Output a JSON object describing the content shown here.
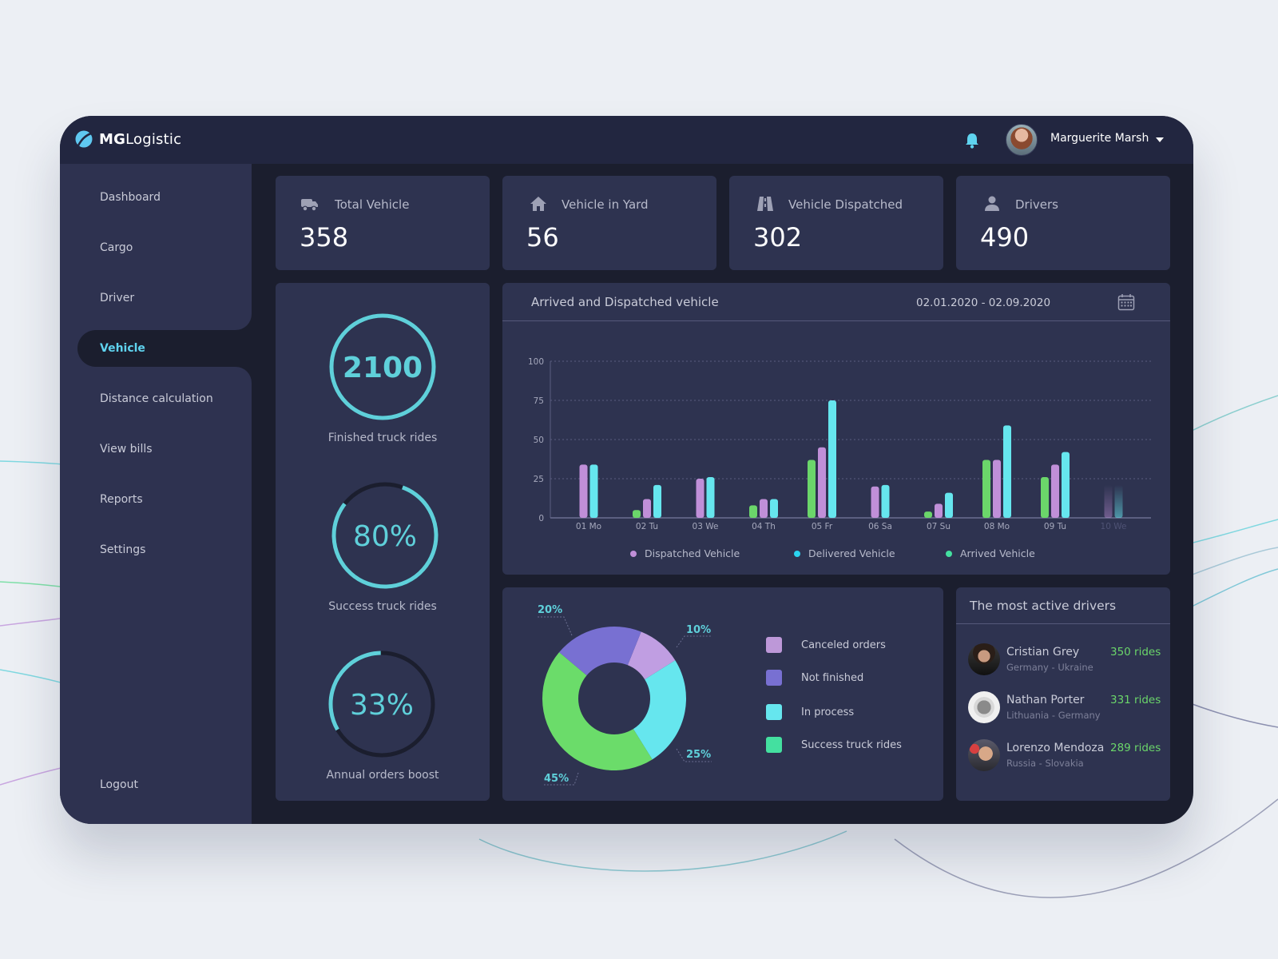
{
  "app": {
    "brand_bold": "MG",
    "brand_light": "Logistic",
    "user_name": "Marguerite Marsh"
  },
  "sidebar": {
    "items": [
      {
        "label": "Dashboard",
        "active": false
      },
      {
        "label": "Cargo",
        "active": false
      },
      {
        "label": "Driver",
        "active": false
      },
      {
        "label": "Vehicle",
        "active": true
      },
      {
        "label": "Distance calculation",
        "active": false
      },
      {
        "label": "View bills",
        "active": false
      },
      {
        "label": "Reports",
        "active": false
      },
      {
        "label": "Settings",
        "active": false
      }
    ],
    "logout": "Logout"
  },
  "stats": [
    {
      "icon": "truck-icon",
      "label": "Total Vehicle",
      "value": "358"
    },
    {
      "icon": "home-icon",
      "label": "Vehicle in Yard",
      "value": "56"
    },
    {
      "icon": "road-icon",
      "label": "Vehicle Dispatched",
      "value": "302"
    },
    {
      "icon": "user-icon",
      "label": "Drivers",
      "value": "490"
    }
  ],
  "rings": [
    {
      "value": "2100",
      "caption": "Finished truck rides",
      "progress": 1.0
    },
    {
      "value": "80%",
      "caption": "Success truck rides",
      "progress": 0.8
    },
    {
      "value": "33%",
      "caption": "Annual orders boost",
      "progress": 0.33
    }
  ],
  "colors": {
    "accent": "#5fd0da",
    "dispatched": "#c08fd8",
    "delivered": "#66e6ee",
    "arrived": "#6bd66a",
    "canceled": "#c09ee2",
    "not_finished": "#7870d2",
    "in_process": "#66e6ee",
    "success": "#6bdc6a",
    "success_legend": "#44e0a0",
    "rides_green": "#6bd66a"
  },
  "bar_chart": {
    "title": "Arrived and Dispatched vehicle",
    "date_range": "02.01.2020 - 02.09.2020"
  },
  "chart_data": [
    {
      "type": "bar",
      "title": "Arrived and Dispatched vehicle",
      "xlabel": "",
      "ylabel": "",
      "ylim": [
        0,
        100
      ],
      "yticks": [
        0,
        25,
        50,
        75,
        100
      ],
      "grid": true,
      "legend_position": "bottom",
      "categories": [
        "01 Mo",
        "02 Tu",
        "03 We",
        "04 Th",
        "05 Fr",
        "06 Sa",
        "07 Su",
        "08 Mo",
        "09 Tu",
        "10 We"
      ],
      "faded_categories": [
        "10 We"
      ],
      "series": [
        {
          "name": "Arrived Vehicle",
          "values": [
            null,
            5,
            null,
            8,
            37,
            null,
            4,
            37,
            26,
            null
          ]
        },
        {
          "name": "Dispatched Vehicle",
          "values": [
            34,
            12,
            25,
            12,
            45,
            20,
            9,
            37,
            34,
            21
          ]
        },
        {
          "name": "Delivered Vehicle",
          "values": [
            34,
            21,
            26,
            12,
            75,
            21,
            16,
            59,
            42,
            21
          ]
        }
      ],
      "legend": [
        "Dispatched Vehicle",
        "Delivered Vehicle",
        "Arrived Vehicle"
      ]
    },
    {
      "type": "pie",
      "donut": true,
      "title": "",
      "legend_position": "right",
      "categories": [
        "Canceled orders",
        "In process",
        "Success truck rides",
        "Not finished"
      ],
      "values": [
        10,
        25,
        45,
        20
      ],
      "labels": [
        "10%",
        "25%",
        "45%",
        "20%"
      ],
      "legend": [
        "Canceled orders",
        "Not finished",
        "In process",
        "Success truck rides"
      ]
    }
  ],
  "drivers": {
    "title": "The most active drivers",
    "list": [
      {
        "name": "Cristian Grey",
        "route": "Germany - Ukraine",
        "rides": "350 rides"
      },
      {
        "name": "Nathan Porter",
        "route": "Lithuania - Germany",
        "rides": "331 rides"
      },
      {
        "name": "Lorenzo Mendoza",
        "route": "Russia - Slovakia",
        "rides": "289 rides"
      }
    ]
  }
}
